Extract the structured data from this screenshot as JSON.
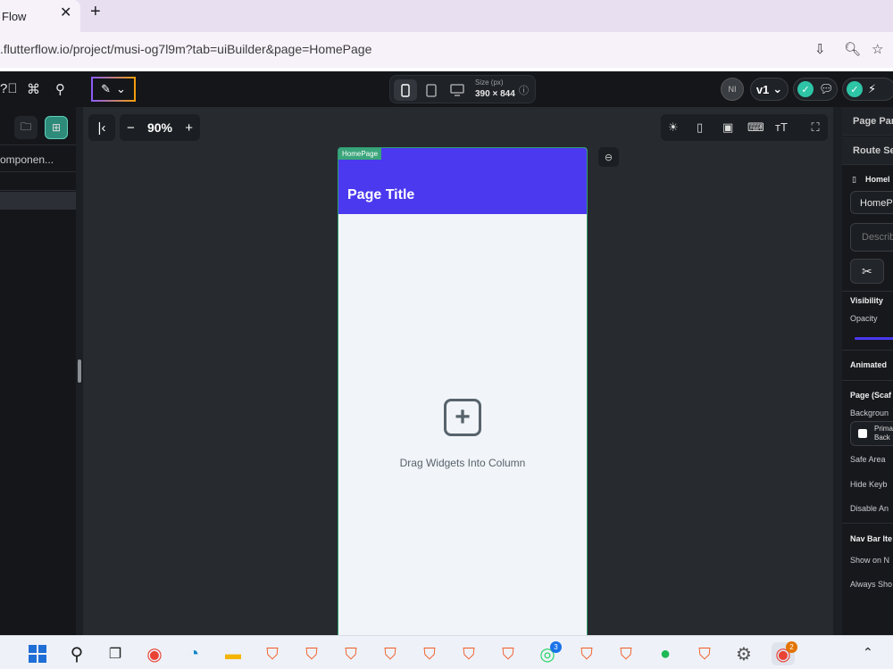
{
  "browser": {
    "tab_title": "Flow",
    "tab_close": "✕",
    "new_tab": "+",
    "url": ".flutterflow.io/project/musi-og7l9m?tab=uiBuilder&page=HomePage"
  },
  "toolbar": {
    "device": {
      "size_label": "Size (px)",
      "size_value": "390 × 844"
    },
    "avatar_initials": "NI",
    "version": "v1"
  },
  "left_panel": {
    "components_label": "omponen..."
  },
  "canvas": {
    "zoom": "90%",
    "zoom_minus": "−",
    "zoom_plus": "+",
    "page_tag": "HomePage",
    "page_title": "Page Title",
    "empty_hint": "Drag Widgets Into Column",
    "add_glyph": "+"
  },
  "right_panel": {
    "tab_page_params": "Page Par",
    "tab_route": "Route Se",
    "page_name_label": "Homel",
    "page_name_value": "HomePa",
    "description_placeholder": "Describ",
    "visibility_label": "Visibility",
    "opacity_label": "Opacity",
    "animated_label": "Animated",
    "page_scaffold_label": "Page (Scaf",
    "background_label": "Backgroun",
    "primary_bg_label_1": "Prima",
    "primary_bg_label_2": "Back",
    "safe_area_label": "Safe Area",
    "hide_keyboard_label": "Hide Keyb",
    "disable_anim_label": "Disable An",
    "nav_bar_label": "Nav Bar Ite",
    "show_on_nav_label": "Show on N",
    "always_show_label": "Always Sho"
  },
  "taskbar": {
    "whatsapp_badge": "3",
    "chrome_badge": "2"
  },
  "colors": {
    "app_bar": "#4b39ef",
    "accent_green": "#2ec4a6",
    "canvas_bg": "#272a2f"
  }
}
